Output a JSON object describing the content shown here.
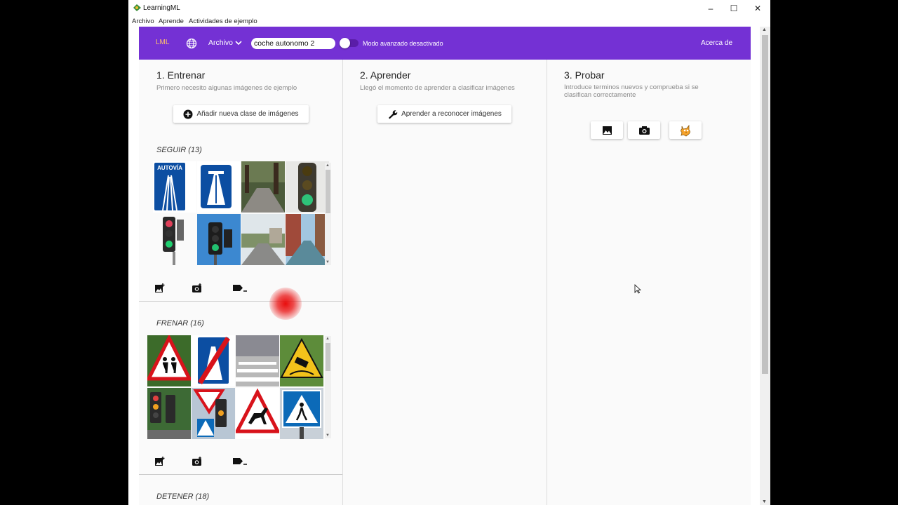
{
  "window": {
    "title": "LearningML"
  },
  "menubar": [
    "Archivo",
    "Aprende",
    "Actividades de ejemplo"
  ],
  "appbar": {
    "logo": "LML",
    "archivo": "Archivo",
    "project_name": "coche autonomo 2",
    "mode_label": "Modo avanzado desactivado",
    "about": "Acerca de",
    "colors": {
      "purple": "#7431d4",
      "logo": "#ffc36b"
    }
  },
  "col1": {
    "heading": "1. Entrenar",
    "subtitle": "Primero necesito algunas imágenes de ejemplo",
    "add_class": "Añadir nueva clase de imágenes"
  },
  "col2": {
    "heading": "2. Aprender",
    "subtitle": "Llegó el momento de aprender a clasificar imágenes",
    "learn_button": "Aprender a reconocer imágenes"
  },
  "col3": {
    "heading": "3. Probar",
    "subtitle_line1": "Introduce terminos nuevos y comprueba si se",
    "subtitle_line2": "clasifican correctamente",
    "buttons": [
      "image-icon",
      "camera-icon",
      "scratch-cat-icon"
    ]
  },
  "classes": [
    {
      "name": "SEGUIR (13)"
    },
    {
      "name": "FRENAR (16)"
    },
    {
      "name": "DETENER (18)"
    }
  ],
  "signs": {
    "autovia": "AUTOVÍA"
  }
}
